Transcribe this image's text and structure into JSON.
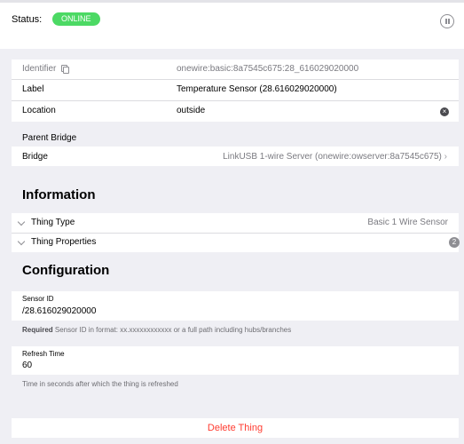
{
  "status": {
    "label": "Status:",
    "badge": "ONLINE",
    "badge_color": "#4cd964"
  },
  "details": {
    "identifier_label": "Identifier",
    "identifier_value": "onewire:basic:8a7545c675:28_616029020000",
    "label_label": "Label",
    "label_value": "Temperature Sensor (28.616029020000)",
    "location_label": "Location",
    "location_value": "outside"
  },
  "parent_bridge": {
    "title": "Parent Bridge",
    "bridge_label": "Bridge",
    "bridge_value": "LinkUSB 1-wire Server (onewire:owserver:8a7545c675)"
  },
  "information": {
    "title": "Information",
    "thing_type_label": "Thing Type",
    "thing_type_value": "Basic 1 Wire Sensor",
    "thing_properties_label": "Thing Properties",
    "thing_properties_count": "2"
  },
  "configuration": {
    "title": "Configuration",
    "sensor_id_label": "Sensor ID",
    "sensor_id_value": "/28.616029020000",
    "sensor_id_help_bold": "Required",
    "sensor_id_help": " Sensor ID in format: xx.xxxxxxxxxxxx or a full path including hubs/branches",
    "refresh_label": "Refresh Time",
    "refresh_value": "60",
    "refresh_help": "Time in seconds after which the thing is refreshed"
  },
  "actions": {
    "delete_label": "Delete Thing",
    "delete_color": "#ff3b30"
  },
  "icons": [
    "pause-icon",
    "copy-icon",
    "clear-icon",
    "chevron-right-icon",
    "chevron-down-icon"
  ]
}
